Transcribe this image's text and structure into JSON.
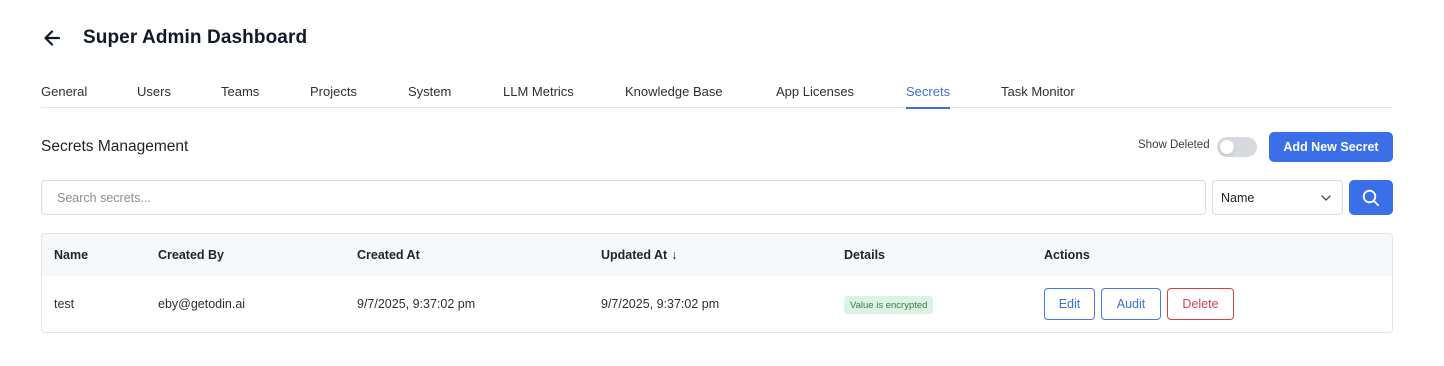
{
  "header": {
    "title": "Super Admin Dashboard",
    "back_icon": "arrow-left-icon"
  },
  "tabs": [
    {
      "label": "General",
      "active": false
    },
    {
      "label": "Users",
      "active": false
    },
    {
      "label": "Teams",
      "active": false
    },
    {
      "label": "Projects",
      "active": false
    },
    {
      "label": "System",
      "active": false
    },
    {
      "label": "LLM Metrics",
      "active": false
    },
    {
      "label": "Knowledge Base",
      "active": false
    },
    {
      "label": "App Licenses",
      "active": false
    },
    {
      "label": "Secrets",
      "active": true
    },
    {
      "label": "Task Monitor",
      "active": false
    }
  ],
  "section": {
    "title": "Secrets Management",
    "show_deleted_label": "Show Deleted",
    "show_deleted_on": false,
    "add_button_label": "Add New Secret"
  },
  "search": {
    "placeholder": "Search secrets...",
    "value": "",
    "field_select_value": "Name",
    "search_icon": "search-icon"
  },
  "table": {
    "columns": [
      "Name",
      "Created By",
      "Created At",
      "Updated At",
      "Details",
      "Actions"
    ],
    "sort_indicator": "↓",
    "rows": [
      {
        "name": "test",
        "created_by": "eby@getodin.ai",
        "created_at": "9/7/2025, 9:37:02 pm",
        "updated_at": "9/7/2025, 9:37:02 pm",
        "details": "Value is encrypted",
        "actions": {
          "edit": "Edit",
          "audit": "Audit",
          "delete": "Delete"
        }
      }
    ]
  },
  "colors": {
    "accent": "#3b6fe8",
    "danger": "#d3414e",
    "badge_bg": "#dcf3e3",
    "badge_text": "#2e7d4f"
  }
}
